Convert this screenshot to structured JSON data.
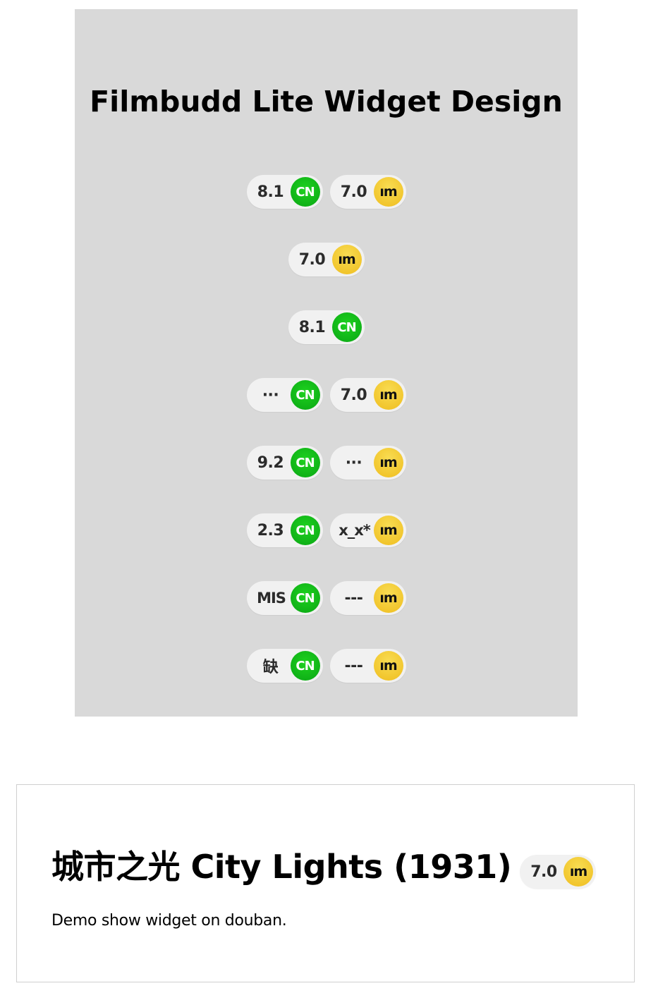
{
  "design": {
    "title": "Filmbudd Lite Widget Design",
    "rows": [
      [
        {
          "score": "8.1",
          "icon": "CN",
          "type": "douban"
        },
        {
          "score": "7.0",
          "icon": "ım",
          "type": "imdb"
        }
      ],
      [
        {
          "score": "7.0",
          "icon": "ım",
          "type": "imdb"
        }
      ],
      [
        {
          "score": "8.1",
          "icon": "CN",
          "type": "douban"
        }
      ],
      [
        {
          "score": "···",
          "icon": "CN",
          "type": "douban"
        },
        {
          "score": "7.0",
          "icon": "ım",
          "type": "imdb"
        }
      ],
      [
        {
          "score": "9.2",
          "icon": "CN",
          "type": "douban"
        },
        {
          "score": "···",
          "icon": "ım",
          "type": "imdb"
        }
      ],
      [
        {
          "score": "2.3",
          "icon": "CN",
          "type": "douban"
        },
        {
          "score": "x_x*",
          "icon": "ım",
          "type": "imdb"
        }
      ],
      [
        {
          "score": "MIS",
          "icon": "CN",
          "type": "douban"
        },
        {
          "score": "---",
          "icon": "ım",
          "type": "imdb"
        }
      ],
      [
        {
          "score": "缺",
          "icon": "CN",
          "type": "douban"
        },
        {
          "score": "---",
          "icon": "ım",
          "type": "imdb"
        }
      ]
    ]
  },
  "demo": {
    "movie_title": "城市之光 City Lights (1931)",
    "badge": {
      "score": "7.0",
      "icon": "ım",
      "type": "imdb"
    },
    "description": "Demo show widget on douban."
  },
  "colors": {
    "panel_bg": "#d9d9d9",
    "badge_bg": "#f1f1f1",
    "douban_green": "#12b21a",
    "imdb_yellow": "#f4c737"
  }
}
